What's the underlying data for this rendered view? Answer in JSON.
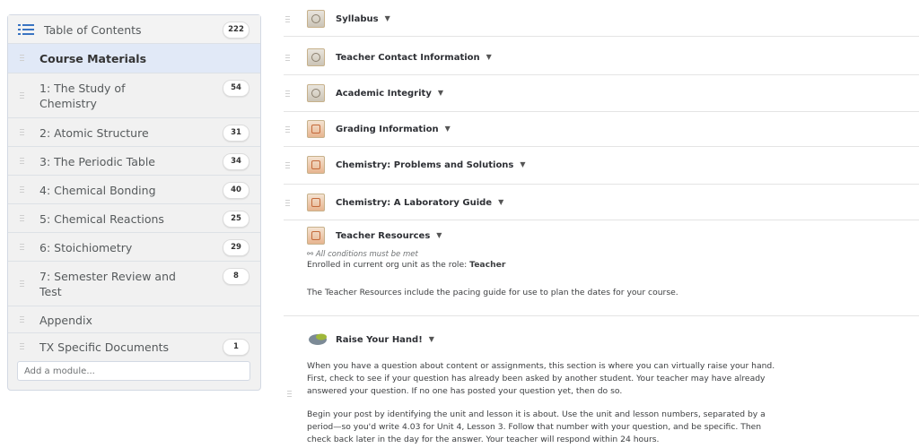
{
  "sidebar": {
    "toc_label": "Table of Contents",
    "toc_count": "222",
    "items": [
      {
        "label": "Course Materials",
        "count": ""
      },
      {
        "label": "1: The Study of Chemistry",
        "count": "54"
      },
      {
        "label": "2: Atomic Structure",
        "count": "31"
      },
      {
        "label": "3: The Periodic Table",
        "count": "34"
      },
      {
        "label": "4: Chemical Bonding",
        "count": "40"
      },
      {
        "label": "5: Chemical Reactions",
        "count": "25"
      },
      {
        "label": "6: Stoichiometry",
        "count": "29"
      },
      {
        "label": "7: Semester Review and Test",
        "count": "8"
      },
      {
        "label": "Appendix",
        "count": ""
      },
      {
        "label": "TX Specific Documents",
        "count": "1"
      }
    ],
    "add_module_placeholder": "Add a module..."
  },
  "modules": [
    {
      "title": "Syllabus",
      "icon": "gray"
    },
    {
      "title": "Teacher Contact Information",
      "icon": "gray"
    },
    {
      "title": "Academic Integrity",
      "icon": "gray"
    },
    {
      "title": "Grading Information",
      "icon": "orange"
    },
    {
      "title": "Chemistry: Problems and Solutions",
      "icon": "orange"
    },
    {
      "title": "Chemistry: A Laboratory Guide",
      "icon": "orange"
    },
    {
      "title": "Teacher Resources",
      "icon": "orange"
    }
  ],
  "teacher_resources": {
    "conditions": "All conditions must be met",
    "enrolled_prefix": "Enrolled in current org unit as the role: ",
    "enrolled_role": "Teacher",
    "description": "The Teacher Resources include the pacing guide for use to plan the dates for your course."
  },
  "raise_hand": {
    "title": "Raise Your Hand!",
    "para1_lines": [
      "When you have a question about content or assignments, this section is where you can virtually raise your hand.",
      "First, check to see if your question has already been asked by another student. Your teacher may have already",
      "answered your question. If no one has posted your question yet, then do so."
    ],
    "para2_lines": [
      "Begin your post by identifying the unit and lesson it is about. Use the unit and lesson numbers, separated by a",
      "period—so you'd write 4.03 for Unit 4, Lesson 3. Follow that number with your question, and be specific. Then",
      "check back later in the day for the answer. Your teacher will respond within 24 hours."
    ]
  },
  "colors": {
    "accent": "#3a74c2",
    "selected_bg": "#e1e9f7",
    "sidebar_bg": "#f1f1f1"
  }
}
